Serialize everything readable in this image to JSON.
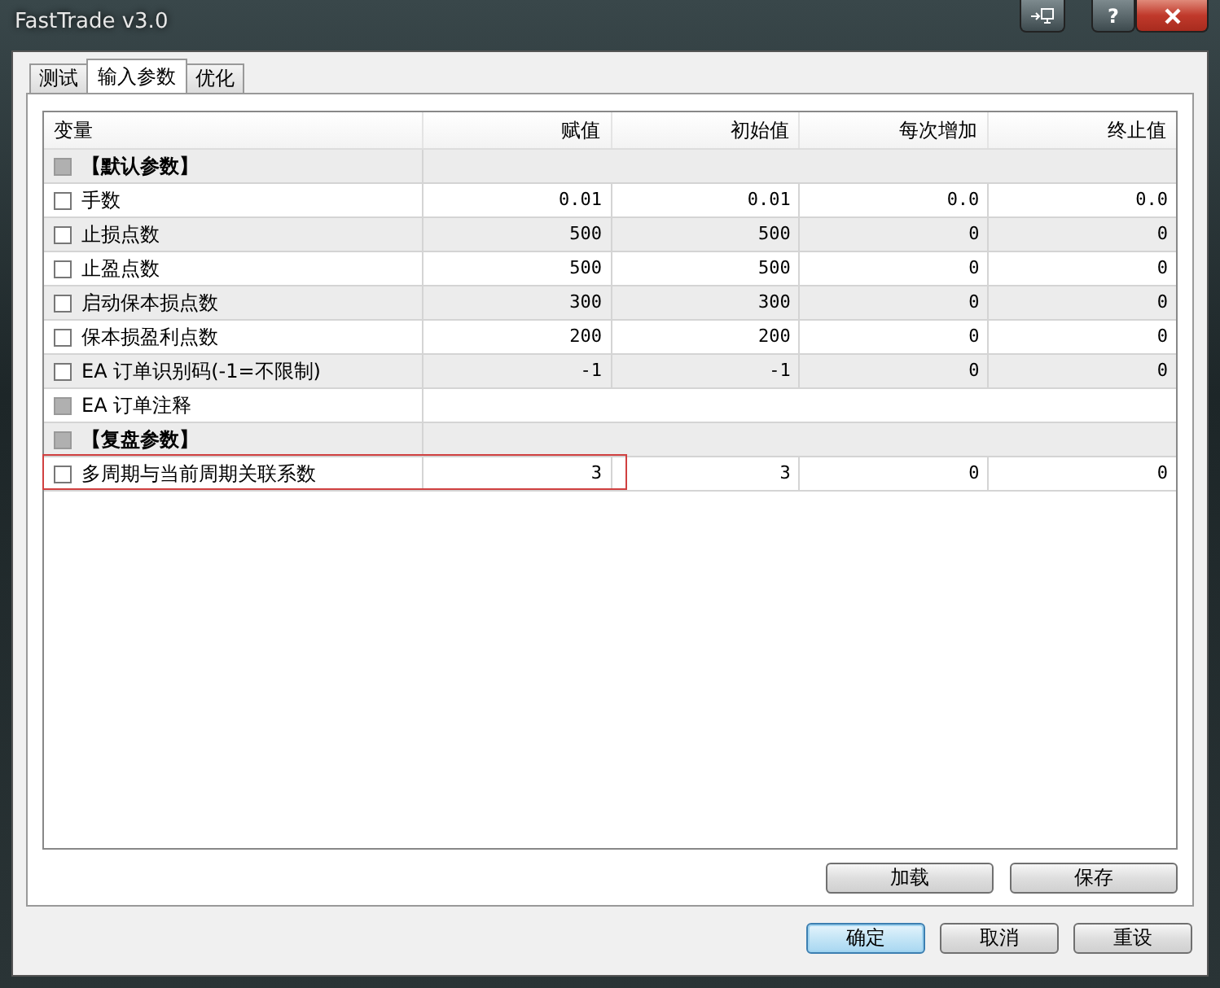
{
  "window": {
    "title": "FastTrade v3.0",
    "help_button": "?"
  },
  "tabs": [
    {
      "label": "测试",
      "selected": false
    },
    {
      "label": "输入参数",
      "selected": true
    },
    {
      "label": "优化",
      "selected": false
    }
  ],
  "table": {
    "columns": [
      "变量",
      "赋值",
      "初始值",
      "每次增加",
      "终止值"
    ],
    "rows": [
      {
        "kind": "group",
        "name": "【默认参数】",
        "checked": false,
        "disabled": true,
        "highlighted": false
      },
      {
        "kind": "param",
        "name": "手数",
        "checked": false,
        "disabled": false,
        "highlighted": false,
        "values": [
          "0.01",
          "0.01",
          "0.0",
          "0.0"
        ]
      },
      {
        "kind": "param",
        "name": "止损点数",
        "checked": false,
        "disabled": false,
        "highlighted": false,
        "values": [
          "500",
          "500",
          "0",
          "0"
        ]
      },
      {
        "kind": "param",
        "name": "止盈点数",
        "checked": false,
        "disabled": false,
        "highlighted": false,
        "values": [
          "500",
          "500",
          "0",
          "0"
        ]
      },
      {
        "kind": "param",
        "name": "启动保本损点数",
        "checked": false,
        "disabled": false,
        "highlighted": false,
        "values": [
          "300",
          "300",
          "0",
          "0"
        ]
      },
      {
        "kind": "param",
        "name": "保本损盈利点数",
        "checked": false,
        "disabled": false,
        "highlighted": false,
        "values": [
          "200",
          "200",
          "0",
          "0"
        ]
      },
      {
        "kind": "param",
        "name": "EA 订单识别码(-1=不限制)",
        "checked": false,
        "disabled": false,
        "highlighted": false,
        "values": [
          "-1",
          "-1",
          "0",
          "0"
        ]
      },
      {
        "kind": "text",
        "name": "EA 订单注释",
        "checked": false,
        "disabled": true,
        "highlighted": false
      },
      {
        "kind": "group",
        "name": "【复盘参数】",
        "checked": false,
        "disabled": true,
        "highlighted": false
      },
      {
        "kind": "param",
        "name": "多周期与当前周期关联系数",
        "checked": false,
        "disabled": false,
        "highlighted": true,
        "values": [
          "3",
          "3",
          "0",
          "0"
        ]
      }
    ]
  },
  "panel_buttons": [
    "加载",
    "保存"
  ],
  "dialog_buttons": [
    {
      "label": "确定",
      "default": true
    },
    {
      "label": "取消",
      "default": false
    },
    {
      "label": "重设",
      "default": false
    }
  ]
}
